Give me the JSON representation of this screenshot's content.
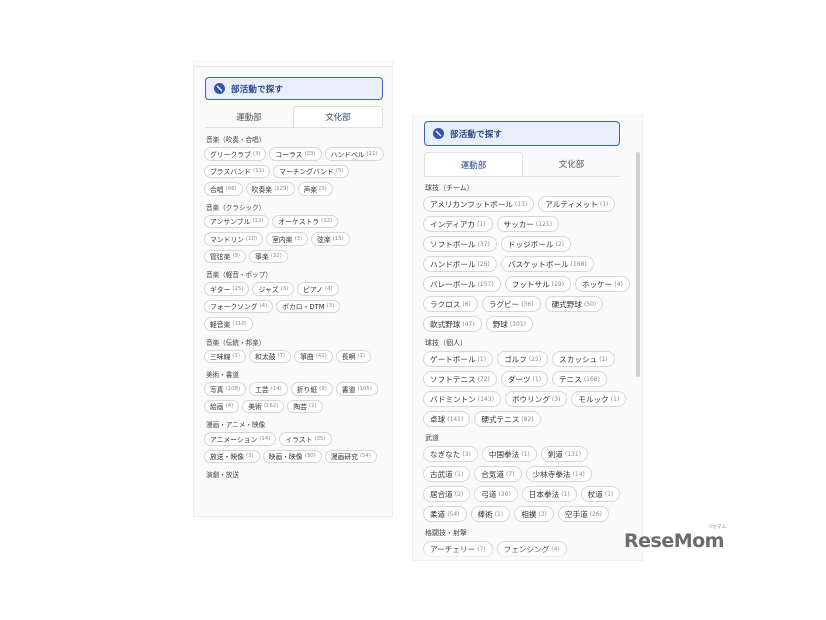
{
  "left_panel": {
    "search_label": "部活動で探す",
    "tabs": [
      {
        "label": "運動部",
        "active": false
      },
      {
        "label": "文化部",
        "active": true
      }
    ],
    "categories": [
      {
        "title": "音楽（吹奏・合唱）",
        "items": [
          {
            "label": "グリークラブ",
            "count": "(3)"
          },
          {
            "label": "コーラス",
            "count": "(23)"
          },
          {
            "label": "ハンドベル",
            "count": "(11)"
          },
          {
            "label": "ブラスバンド",
            "count": "(11)"
          },
          {
            "label": "マーチングバンド",
            "count": "(5)"
          },
          {
            "label": "合唱",
            "count": "(66)"
          },
          {
            "label": "吹奏楽",
            "count": "(129)"
          },
          {
            "label": "声楽",
            "count": "(3)"
          }
        ]
      },
      {
        "title": "音楽（クラシック）",
        "items": [
          {
            "label": "アンサンブル",
            "count": "(12)"
          },
          {
            "label": "オーケストラ",
            "count": "(12)"
          },
          {
            "label": "マンドリン",
            "count": "(10)"
          },
          {
            "label": "室内楽",
            "count": "(3)"
          },
          {
            "label": "弦楽",
            "count": "(15)"
          },
          {
            "label": "管弦楽",
            "count": "(9)"
          },
          {
            "label": "箏楽",
            "count": "(32)"
          }
        ]
      },
      {
        "title": "音楽（軽音・ポップ）",
        "items": [
          {
            "label": "ギター",
            "count": "(25)"
          },
          {
            "label": "ジャズ",
            "count": "(3)"
          },
          {
            "label": "ピアノ",
            "count": "(4)"
          },
          {
            "label": "フォークソング",
            "count": "(4)"
          },
          {
            "label": "ボカロ・DTM",
            "count": "(3)"
          },
          {
            "label": "軽音楽",
            "count": "(110)"
          }
        ]
      },
      {
        "title": "音楽（伝統・邦楽）",
        "items": [
          {
            "label": "三味線",
            "count": "(1)"
          },
          {
            "label": "和太鼓",
            "count": "(7)"
          },
          {
            "label": "箏曲",
            "count": "(42)"
          },
          {
            "label": "長唄",
            "count": "(1)"
          }
        ]
      },
      {
        "title": "美術・書道",
        "items": [
          {
            "label": "写真",
            "count": "(108)"
          },
          {
            "label": "工芸",
            "count": "(14)"
          },
          {
            "label": "折り紙",
            "count": "(9)"
          },
          {
            "label": "書道",
            "count": "(105)"
          },
          {
            "label": "絵画",
            "count": "(4)"
          },
          {
            "label": "美術",
            "count": "(162)"
          },
          {
            "label": "陶芸",
            "count": "(2)"
          }
        ]
      },
      {
        "title": "漫画・アニメ・映像",
        "items": [
          {
            "label": "アニメーション",
            "count": "(14)"
          },
          {
            "label": "イラスト",
            "count": "(35)"
          },
          {
            "label": "放送・映像",
            "count": "(3)"
          },
          {
            "label": "映画・映像",
            "count": "(30)"
          },
          {
            "label": "漫画研究",
            "count": "(54)"
          }
        ]
      },
      {
        "title": "演劇・放送",
        "items": []
      }
    ]
  },
  "right_panel": {
    "search_label": "部活動で探す",
    "tabs": [
      {
        "label": "運動部",
        "active": true
      },
      {
        "label": "文化部",
        "active": false
      }
    ],
    "categories": [
      {
        "title": "球技（チーム）",
        "items": [
          {
            "label": "アメリカンフットボール",
            "count": "(13)"
          },
          {
            "label": "アルティメット",
            "count": "(1)"
          },
          {
            "label": "インディアカ",
            "count": "(1)"
          },
          {
            "label": "サッカー",
            "count": "(121)"
          },
          {
            "label": "ソフトボール",
            "count": "(37)"
          },
          {
            "label": "ドッジボール",
            "count": "(2)"
          },
          {
            "label": "ハンドボール",
            "count": "(26)"
          },
          {
            "label": "バスケットボール",
            "count": "(168)"
          },
          {
            "label": "バレーボール",
            "count": "(157)"
          },
          {
            "label": "フットサル",
            "count": "(19)"
          },
          {
            "label": "ホッケー",
            "count": "(4)"
          },
          {
            "label": "ラクロス",
            "count": "(6)"
          },
          {
            "label": "ラグビー",
            "count": "(36)"
          },
          {
            "label": "硬式野球",
            "count": "(50)"
          },
          {
            "label": "軟式野球",
            "count": "(47)"
          },
          {
            "label": "野球",
            "count": "(101)"
          }
        ]
      },
      {
        "title": "球技（個人）",
        "items": [
          {
            "label": "ゲートボール",
            "count": "(1)"
          },
          {
            "label": "ゴルフ",
            "count": "(25)"
          },
          {
            "label": "スカッシュ",
            "count": "(1)"
          },
          {
            "label": "ソフトテニス",
            "count": "(72)"
          },
          {
            "label": "ダーツ",
            "count": "(1)"
          },
          {
            "label": "テニス",
            "count": "(168)"
          },
          {
            "label": "バドミントン",
            "count": "(143)"
          },
          {
            "label": "ボウリング",
            "count": "(3)"
          },
          {
            "label": "モルック",
            "count": "(1)"
          },
          {
            "label": "卓球",
            "count": "(141)"
          },
          {
            "label": "硬式テニス",
            "count": "(82)"
          }
        ]
      },
      {
        "title": "武道",
        "items": [
          {
            "label": "なぎなた",
            "count": "(3)"
          },
          {
            "label": "中国拳法",
            "count": "(1)"
          },
          {
            "label": "剣道",
            "count": "(131)"
          },
          {
            "label": "古武道",
            "count": "(1)"
          },
          {
            "label": "合気道",
            "count": "(7)"
          },
          {
            "label": "少林寺拳法",
            "count": "(14)"
          },
          {
            "label": "居合道",
            "count": "(2)"
          },
          {
            "label": "弓道",
            "count": "(30)"
          },
          {
            "label": "日本拳法",
            "count": "(1)"
          },
          {
            "label": "杖道",
            "count": "(1)"
          },
          {
            "label": "柔道",
            "count": "(54)"
          },
          {
            "label": "棒術",
            "count": "(1)"
          },
          {
            "label": "相撲",
            "count": "(3)"
          },
          {
            "label": "空手道",
            "count": "(26)"
          }
        ]
      },
      {
        "title": "格闘技・射撃",
        "items": [
          {
            "label": "アーチェリー",
            "count": "(7)"
          },
          {
            "label": "フェンシング",
            "count": "(4)"
          }
        ]
      }
    ]
  },
  "logo": {
    "text": "ReseMom",
    "ruby": "リセマム"
  }
}
